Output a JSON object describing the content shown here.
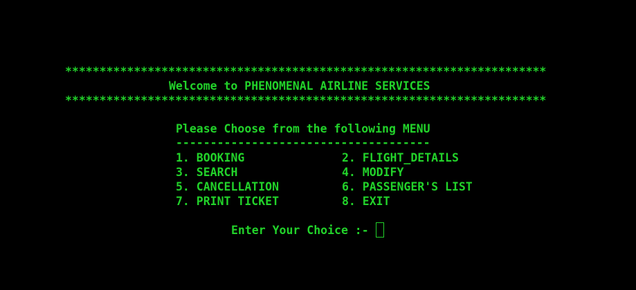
{
  "banner": {
    "stars_top": "**********************************************************************",
    "welcome": "Welcome to PHENOMENAL AIRLINE SERVICES",
    "stars_bottom": "**********************************************************************"
  },
  "menu": {
    "heading": "Please Choose from the following MENU",
    "rule": "-------------------------------------",
    "items": [
      {
        "label": "1. BOOKING"
      },
      {
        "label": "2. FLIGHT_DETAILS"
      },
      {
        "label": "3. SEARCH"
      },
      {
        "label": "4. MODIFY"
      },
      {
        "label": "5. CANCELLATION"
      },
      {
        "label": "6. PASSENGER'S LIST"
      },
      {
        "label": "7. PRINT TICKET"
      },
      {
        "label": "8. EXIT"
      }
    ]
  },
  "prompt": {
    "label": "Enter Your Choice :-"
  },
  "colors": {
    "background": "#000000",
    "text": "#22d22a"
  }
}
